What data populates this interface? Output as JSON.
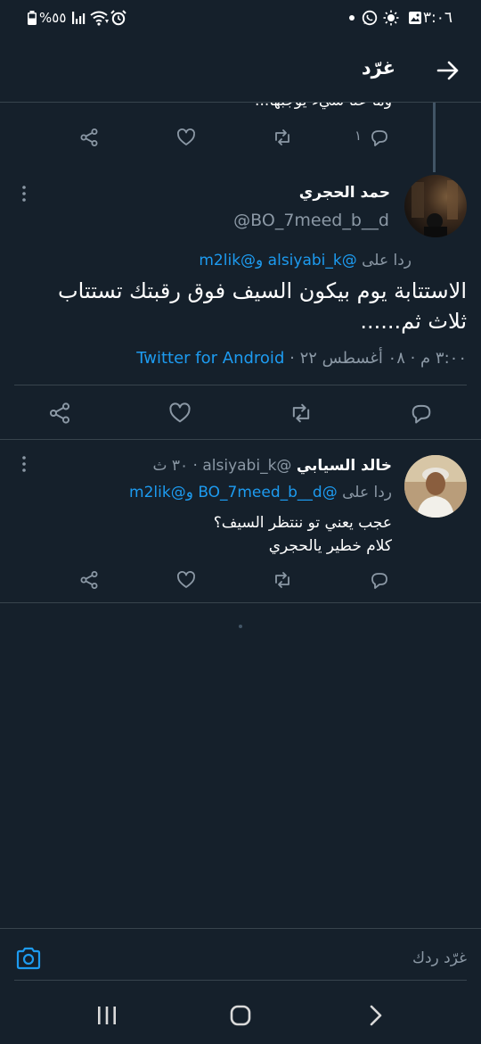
{
  "status_bar": {
    "time": "٣:٠٦",
    "battery": "%٥٥"
  },
  "header": {
    "title": "غرّد"
  },
  "prev_tweet": {
    "text_cut": "وما عنا شيء يوجبها...",
    "reply_count": "١"
  },
  "main_tweet": {
    "name": "حمد الحجري",
    "handle": "@BO_7meed_b__d",
    "reply_prefix": "ردا على",
    "reply_mentions": "@alsiyabi_k و@m2lik",
    "text_line1": "الاستتابة يوم بيكون السيف فوق رقبتك تستتاب",
    "text_line2": "ثلاث ثم......",
    "meta_time": "٣:٠٠ م · ٠٨ أغسطس ٢٢ ·",
    "meta_source": "Twitter for Android"
  },
  "reply_tweet": {
    "name": "خالد السيابي",
    "handle": "@alsiyabi_k",
    "time": "٣٠ ث",
    "reply_prefix": "ردا على",
    "reply_mentions": "@BO_7meed_b__d و@m2lik",
    "text_line1": "عجب يعني تو ننتظر السيف؟",
    "text_line2": "كلام خطير يالحجري"
  },
  "compose": {
    "placeholder": "غرّد ردك"
  },
  "colors": {
    "background": "#15202b",
    "accent": "#1d9bf0",
    "secondary_text": "#8b98a5",
    "divider": "#38444d"
  }
}
